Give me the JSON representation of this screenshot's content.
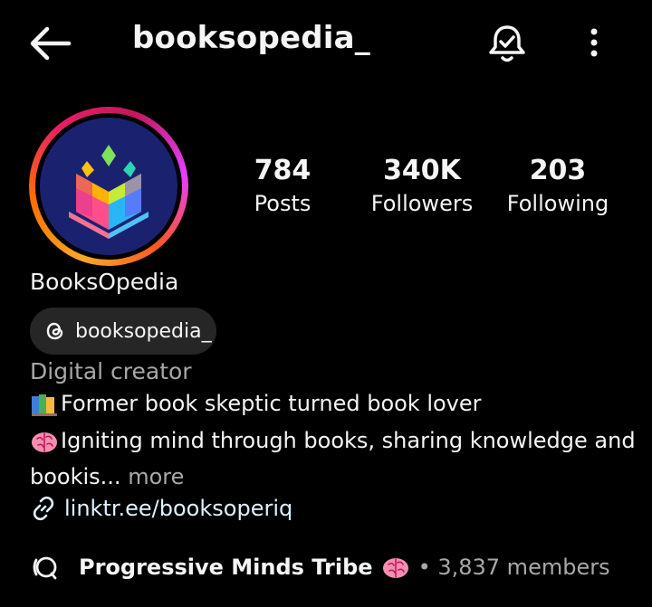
{
  "header": {
    "username": "booksopedia_",
    "icons": {
      "back": "back-arrow-icon",
      "notifications": "bell-check-icon",
      "more": "more-vertical-icon"
    }
  },
  "profile": {
    "avatar_icon": "open-book-logo-icon",
    "stats": {
      "posts": {
        "value": "784",
        "label": "Posts"
      },
      "followers": {
        "value": "340K",
        "label": "Followers"
      },
      "following": {
        "value": "203",
        "label": "Following"
      }
    },
    "display_name": "BooksOpedia",
    "threads_handle": "booksopedia_",
    "category": "Digital creator",
    "bio": {
      "line1": "Former book skeptic turned book lover",
      "line2": "Igniting mind through books, sharing knowledge and",
      "line3": "bookis...",
      "more": " more"
    },
    "link": "linktr.ee/booksoperiq"
  },
  "channel": {
    "name": "Progressive Minds Tribe",
    "members": "• 3,837 members"
  },
  "colors": {
    "background": "#000000",
    "text": "#f5f5f5",
    "muted": "#a8a8a8",
    "chip": "#262626",
    "link": "#e0f1ff"
  }
}
